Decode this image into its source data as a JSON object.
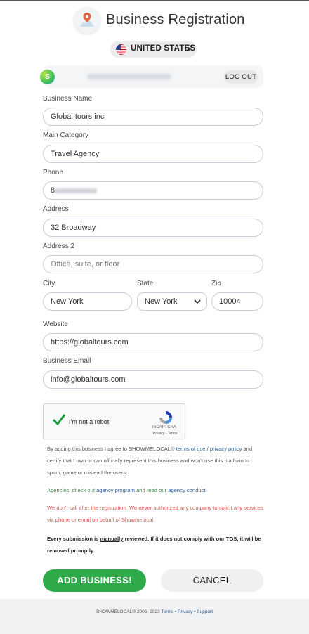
{
  "header": {
    "title": "Business Registration",
    "country": "UNITED STATES"
  },
  "user": {
    "avatar_letter": "S",
    "logout_label": "LOG OUT"
  },
  "form": {
    "business_name": {
      "label": "Business Name",
      "value": "Global tours inc"
    },
    "main_category": {
      "label": "Main Category",
      "value": "Travel Agency"
    },
    "phone": {
      "label": "Phone",
      "value": "8"
    },
    "address": {
      "label": "Address",
      "value": "32 Broadway"
    },
    "address2": {
      "label": "Address 2",
      "placeholder": "Office, suite, or floor"
    },
    "city": {
      "label": "City",
      "value": "New York"
    },
    "state": {
      "label": "State",
      "value": "New York"
    },
    "zip": {
      "label": "Zip",
      "value": "10004"
    },
    "website": {
      "label": "Website",
      "value": "https://globaltours.com"
    },
    "business_email": {
      "label": "Business Email",
      "value": "info@globaltours.com"
    }
  },
  "recaptcha": {
    "label": "I'm not a robot",
    "brand": "reCAPTCHA",
    "links": "Privacy - Terms"
  },
  "notices": {
    "agree_prefix": "By adding this business I agree to SHOWMELOCAL® ",
    "terms_link": "terms of use / privacy policy",
    "agree_suffix": " and certify that I own or can officially represent this business and won't use this platform to spam, game or mislead the users.",
    "agencies_prefix": "Agencies, check out ",
    "agency_program_link": "agency program",
    "agencies_middle": " and read our ",
    "agency_conduct_link": "agency conduct",
    "warning": "We don't call after the registration. We never authorized any company to solicit any services via phone or email on behalf of Showmelocal.",
    "review_prefix": "Every submission is ",
    "review_emphasis": "manually",
    "review_suffix": " reviewed. If it does not comply with our TOS, it will be removed promptly."
  },
  "buttons": {
    "add": "ADD BUSINESS!",
    "cancel": "CANCEL"
  },
  "footer": {
    "copyright": "SHOWMELOCAL® 2006- 2023 ",
    "terms": "Terms",
    "sep1": " • ",
    "privacy": "Privacy",
    "sep2": " • ",
    "support": "Support"
  },
  "colors": {
    "primary_green": "#2eaa4a",
    "link_blue": "#2d5d8f",
    "notice_green": "#3c8a4d",
    "notice_red": "#d2554f"
  },
  "icons": {
    "logo": "map-pin-icon",
    "flag": "us-flag-icon",
    "dropdown": "caret-down-icon",
    "check": "checkmark-icon",
    "recaptcha": "recaptcha-icon"
  }
}
